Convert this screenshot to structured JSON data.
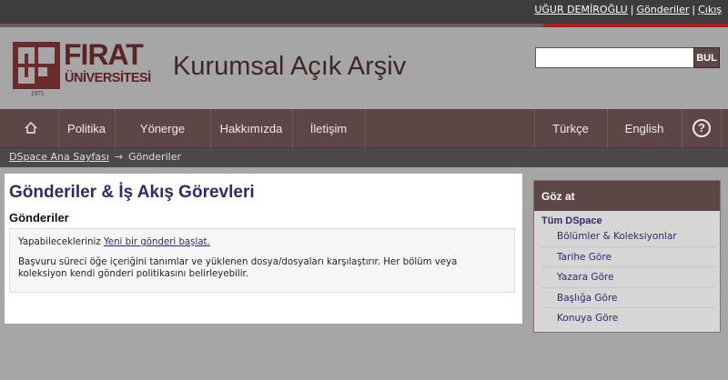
{
  "user_bar": {
    "user_name": "UĞUR DEMİROĞLU",
    "sep1": "|",
    "submissions_link": "Gönderiler",
    "sep2": "|",
    "logout_link": "Çıkış"
  },
  "header": {
    "logo_word1": "FIRAT",
    "logo_word2": "ÜNİVERSİTESİ",
    "logo_year": "1975",
    "site_title": "Kurumsal Açık Arşiv"
  },
  "search": {
    "placeholder": "",
    "button_label": "BUL"
  },
  "nav": {
    "home_icon": "home-icon",
    "items": [
      "Politika",
      "Yönerge",
      "Hakkımızda",
      "İletişim"
    ],
    "languages": [
      "Türkçe",
      "English"
    ],
    "help_icon": "help-icon",
    "help_glyph": "?"
  },
  "breadcrumb": {
    "home": "DSpace Ana Sayfası",
    "arrow": "→",
    "current": "Gönderiler"
  },
  "main": {
    "title": "Gönderiler & İş Akış Görevleri",
    "section_title": "Gönderiler",
    "line1_prefix": "Yapabilecekleriniz",
    "line1_link": "Yeni bir gönderi başlat.",
    "line2": "Başvuru süreci öğe içeriğini tanımlar ve yüklenen dosya/dosyaları karşılaştırır. Her bölüm veya koleksiyon kendi gönderi politikasını belirleyebilir."
  },
  "sidebar": {
    "heading": "Göz at",
    "subheading": "Tüm DSpace",
    "links": [
      "Bölümler & Koleksiyonlar",
      "Tarihe Göre",
      "Yazara Göre",
      "Başlığa Göre",
      "Konuya Göre"
    ]
  },
  "colors": {
    "nav_bg": "#5c4646",
    "accent_red": "#b31b1b",
    "link": "#2a2c6e"
  }
}
